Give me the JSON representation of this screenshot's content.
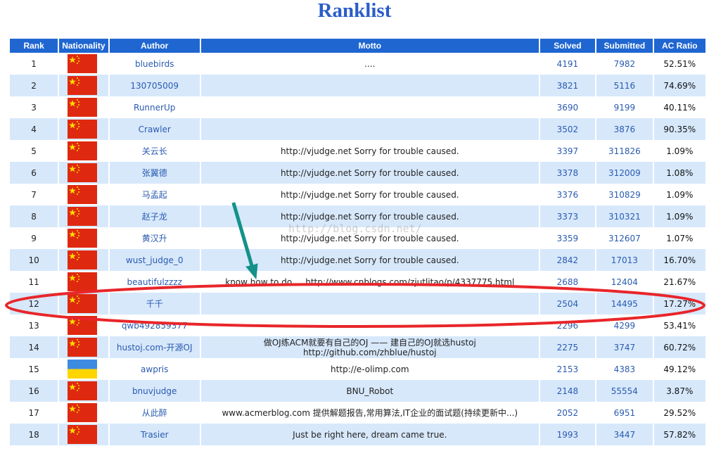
{
  "page": {
    "title": "Ranklist",
    "watermark": "http://blog.csdn.net/"
  },
  "table": {
    "headers": {
      "rank": "Rank",
      "nationality": "Nationality",
      "author": "Author",
      "motto": "Motto",
      "solved": "Solved",
      "submitted": "Submitted",
      "ac_ratio": "AC Ratio"
    },
    "rows": [
      {
        "rank": "1",
        "flag": "china-flag-icon",
        "author": "bluebirds",
        "motto": "....",
        "solved": "4191",
        "submitted": "7982",
        "ac_ratio": "52.51%"
      },
      {
        "rank": "2",
        "flag": "china-flag-icon",
        "author": "130705009",
        "motto": "",
        "solved": "3821",
        "submitted": "5116",
        "ac_ratio": "74.69%"
      },
      {
        "rank": "3",
        "flag": "china-flag-icon",
        "author": "RunnerUp",
        "motto": "",
        "solved": "3690",
        "submitted": "9199",
        "ac_ratio": "40.11%"
      },
      {
        "rank": "4",
        "flag": "china-flag-icon",
        "author": "Crawler",
        "motto": "",
        "solved": "3502",
        "submitted": "3876",
        "ac_ratio": "90.35%"
      },
      {
        "rank": "5",
        "flag": "china-flag-icon",
        "author": "关云长",
        "motto": "http://vjudge.net Sorry for trouble caused.",
        "solved": "3397",
        "submitted": "311826",
        "ac_ratio": "1.09%"
      },
      {
        "rank": "6",
        "flag": "china-flag-icon",
        "author": "张翼德",
        "motto": "http://vjudge.net Sorry for trouble caused.",
        "solved": "3378",
        "submitted": "312009",
        "ac_ratio": "1.08%"
      },
      {
        "rank": "7",
        "flag": "china-flag-icon",
        "author": "马孟起",
        "motto": "http://vjudge.net Sorry for trouble caused.",
        "solved": "3376",
        "submitted": "310829",
        "ac_ratio": "1.09%"
      },
      {
        "rank": "8",
        "flag": "china-flag-icon",
        "author": "赵子龙",
        "motto": "http://vjudge.net Sorry for trouble caused.",
        "solved": "3373",
        "submitted": "310321",
        "ac_ratio": "1.09%"
      },
      {
        "rank": "9",
        "flag": "china-flag-icon",
        "author": "黄汉升",
        "motto": "http://vjudge.net Sorry for trouble caused.",
        "solved": "3359",
        "submitted": "312607",
        "ac_ratio": "1.07%"
      },
      {
        "rank": "10",
        "flag": "china-flag-icon",
        "author": "wust_judge_0",
        "motto": "http://vjudge.net Sorry for trouble caused.",
        "solved": "2842",
        "submitted": "17013",
        "ac_ratio": "16.70%"
      },
      {
        "rank": "11",
        "flag": "china-flag-icon",
        "author": "beautifulzzzz",
        "motto": "know how to do ... http://www.cnblogs.com/zjutlitao/p/4337775.html",
        "solved": "2688",
        "submitted": "12404",
        "ac_ratio": "21.67%"
      },
      {
        "rank": "12",
        "flag": "china-flag-icon",
        "author": "千千",
        "motto": "",
        "solved": "2504",
        "submitted": "14495",
        "ac_ratio": "17.27%"
      },
      {
        "rank": "13",
        "flag": "china-flag-icon",
        "author": "qwb492859377",
        "motto": "",
        "solved": "2296",
        "submitted": "4299",
        "ac_ratio": "53.41%"
      },
      {
        "rank": "14",
        "flag": "china-flag-icon",
        "author": "hustoj.com-开源OJ",
        "motto": "做OJ练ACM就要有自己的OJ —— 建自己的OJ就选hustoj\nhttp://github.com/zhblue/hustoj",
        "solved": "2275",
        "submitted": "3747",
        "ac_ratio": "60.72%"
      },
      {
        "rank": "15",
        "flag": "ukraine-flag-icon",
        "author": "awpris",
        "motto": "http://e-olimp.com",
        "solved": "2153",
        "submitted": "4383",
        "ac_ratio": "49.12%"
      },
      {
        "rank": "16",
        "flag": "china-flag-icon",
        "author": "bnuvjudge",
        "motto": "BNU_Robot",
        "solved": "2148",
        "submitted": "55554",
        "ac_ratio": "3.87%"
      },
      {
        "rank": "17",
        "flag": "china-flag-icon",
        "author": "从此醉",
        "motto": "www.acmerblog.com  提供解题报告,常用算法,IT企业的面试题(持续更新中...)",
        "solved": "2052",
        "submitted": "6951",
        "ac_ratio": "29.52%"
      },
      {
        "rank": "18",
        "flag": "china-flag-icon",
        "author": "Trasier",
        "motto": "Just be right here, dream came true.",
        "solved": "1993",
        "submitted": "3447",
        "ac_ratio": "57.82%"
      }
    ]
  },
  "annotation": {
    "highlighted_rank": "12",
    "ellipse_color": "#e8262a",
    "arrow_color": "#14928a"
  },
  "colors": {
    "header_bg": "#1f66d1",
    "row_alt_bg": "#d7e8fb",
    "title": "#2a5dc8",
    "link": "#2a5bb0"
  }
}
